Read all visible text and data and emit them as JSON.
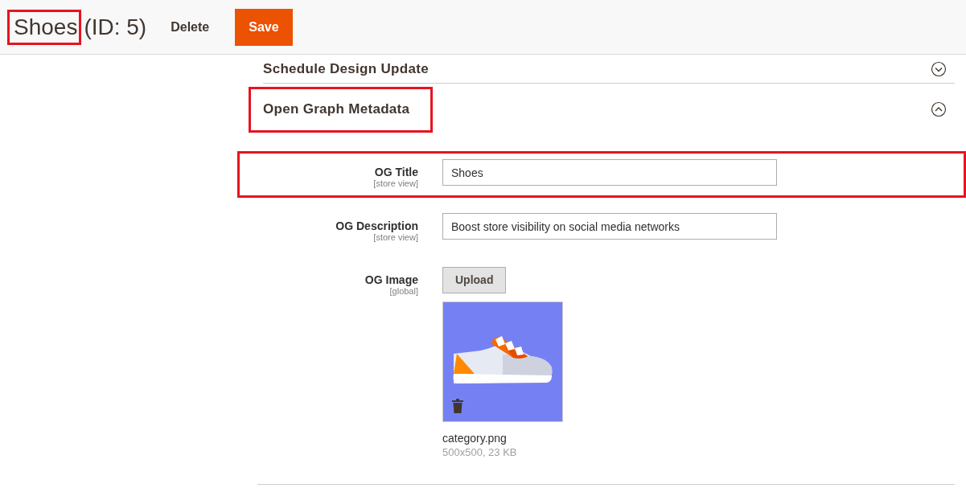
{
  "header": {
    "title": "Shoes",
    "title_highlighted": true,
    "id_text": "(ID: 5)",
    "buttons": [
      {
        "label": "Delete",
        "kind": "plain"
      },
      {
        "label": "Save",
        "kind": "primary"
      }
    ]
  },
  "sections": [
    {
      "title": "Schedule Design Update",
      "expanded": false,
      "highlighted": false
    },
    {
      "title": "Open Graph Metadata",
      "expanded": true,
      "highlighted": true,
      "fields": [
        {
          "kind": "text",
          "label": "OG Title",
          "scope": "[store view]",
          "value": "Shoes",
          "highlighted": true
        },
        {
          "kind": "text",
          "label": "OG Description",
          "scope": "[store view]",
          "value": "Boost store visibility on social media networks",
          "highlighted": false
        },
        {
          "label": "OG Image",
          "scope": "[global]",
          "button": "Upload",
          "file_name": "category.png",
          "file_info": "500x500, 23 KB",
          "highlighted": false
        }
      ]
    }
  ]
}
